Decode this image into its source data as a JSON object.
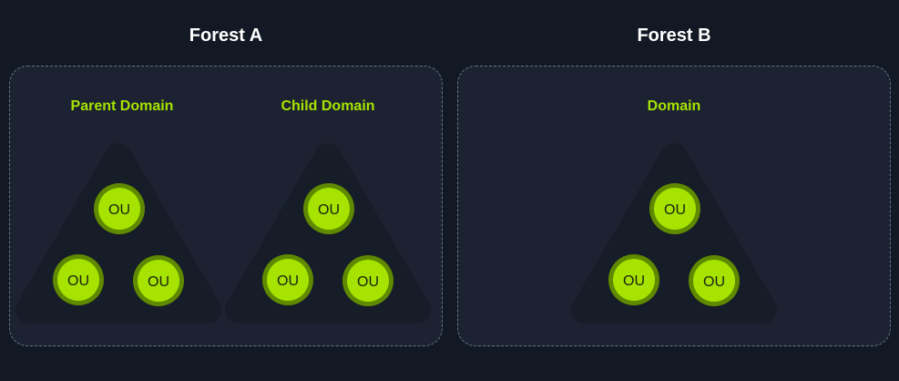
{
  "forests": [
    {
      "title": "Forest A",
      "domains": [
        {
          "label": "Parent Domain",
          "ous": [
            "OU",
            "OU",
            "OU"
          ]
        },
        {
          "label": "Child Domain",
          "ous": [
            "OU",
            "OU",
            "OU"
          ]
        }
      ]
    },
    {
      "title": "Forest B",
      "domains": [
        {
          "label": "Domain",
          "ous": [
            "OU",
            "OU",
            "OU"
          ]
        }
      ]
    }
  ],
  "colors": {
    "accent": "#a6e300",
    "ou_ring": "#5f8a00",
    "triangle": "#161c28"
  }
}
